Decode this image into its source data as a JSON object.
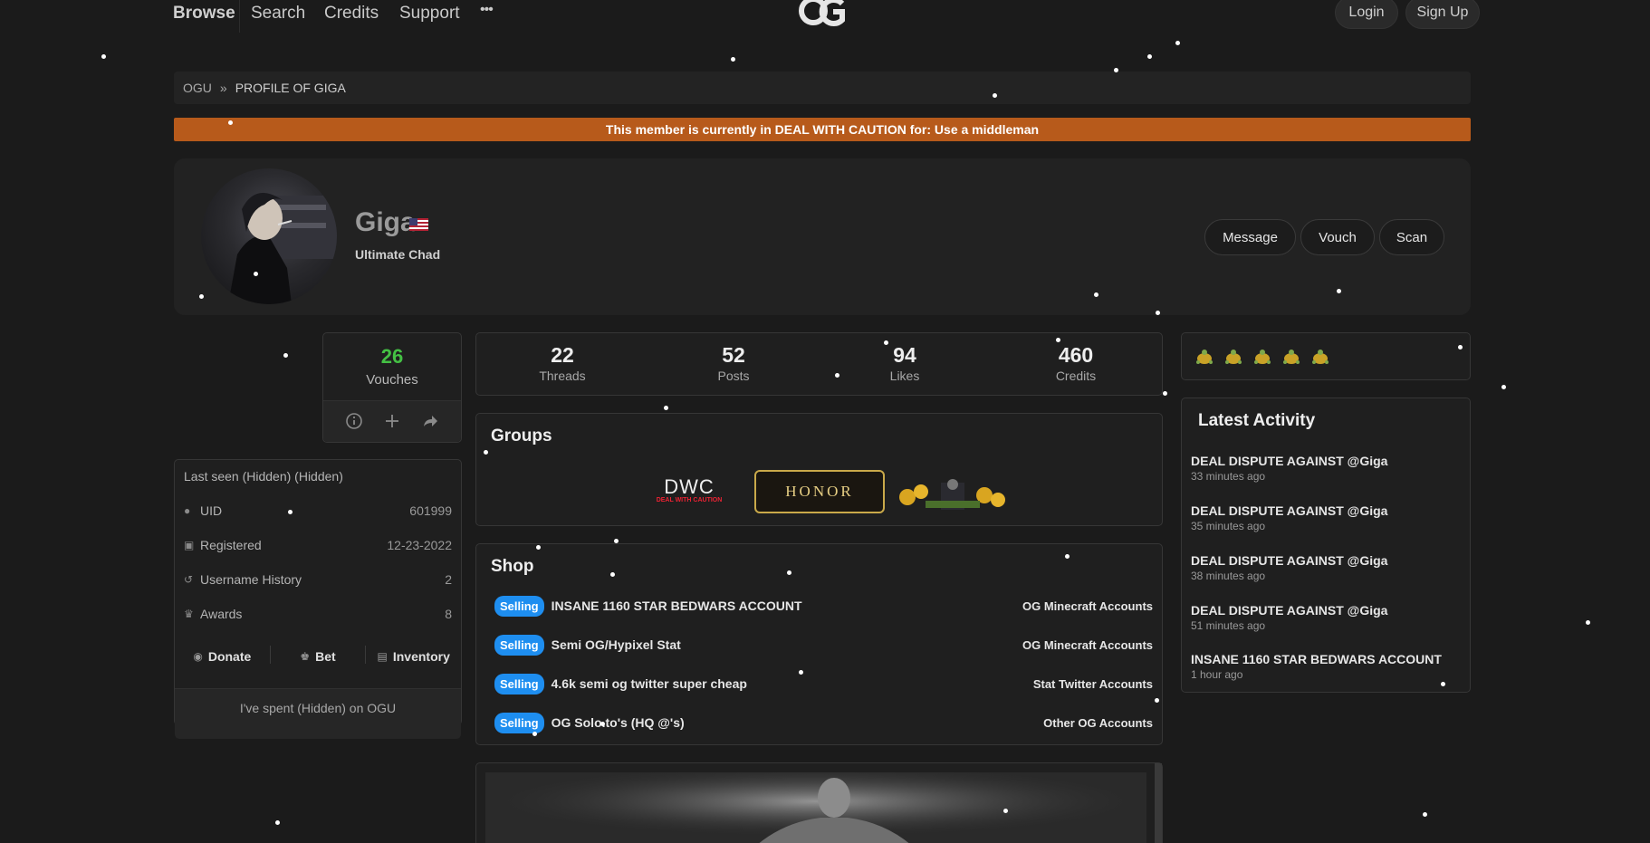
{
  "nav": {
    "links": [
      "Browse",
      "Search",
      "Credits",
      "Support"
    ],
    "more": "•••",
    "login": "Login",
    "signup": "Sign Up"
  },
  "breadcrumb": {
    "root": "OGU",
    "current": "PROFILE OF GIGA"
  },
  "caution_banner": "This member is currently in DEAL WITH CAUTION for: Use a middleman",
  "profile": {
    "username": "Giga",
    "user_title": "Ultimate Chad",
    "actions": [
      "Message",
      "Vouch",
      "Scan"
    ]
  },
  "vouches": {
    "count": "26",
    "label": "Vouches"
  },
  "info": {
    "last_seen": "Last seen (Hidden) (Hidden)",
    "rows": [
      {
        "label": "UID",
        "value": "601999"
      },
      {
        "label": "Registered",
        "value": "12-23-2022"
      },
      {
        "label": "Username History",
        "value": "2"
      },
      {
        "label": "Awards",
        "value": "8"
      }
    ],
    "links": [
      "Donate",
      "Bet",
      "Inventory"
    ],
    "spent": "I've spent (Hidden) on OGU"
  },
  "stats": [
    {
      "value": "22",
      "label": "Threads"
    },
    {
      "value": "52",
      "label": "Posts"
    },
    {
      "value": "94",
      "label": "Likes"
    },
    {
      "value": "460",
      "label": "Credits"
    }
  ],
  "groups": {
    "title": "Groups",
    "banners": [
      "DWC",
      "DEAL WITH CAUTION",
      "HONOR"
    ]
  },
  "shop": {
    "title": "Shop",
    "badge": "Selling",
    "items": [
      {
        "name": "INSANE 1160 STAR BEDWARS ACCOUNT",
        "category": "OG Minecraft Accounts"
      },
      {
        "name": "Semi OG/Hypixel Stat",
        "category": "OG Minecraft Accounts"
      },
      {
        "name": "4.6k semi og twitter super cheap",
        "category": "Stat Twitter Accounts"
      },
      {
        "name": "OG Solo.to's (HQ @'s)",
        "category": "Other OG Accounts"
      }
    ]
  },
  "activity": {
    "title": "Latest Activity",
    "items": [
      {
        "text": "DEAL DISPUTE AGAINST @Giga",
        "time": "33 minutes ago"
      },
      {
        "text": "DEAL DISPUTE AGAINST @Giga",
        "time": "35 minutes ago"
      },
      {
        "text": "DEAL DISPUTE AGAINST @Giga",
        "time": "38 minutes ago"
      },
      {
        "text": "DEAL DISPUTE AGAINST @Giga",
        "time": "51 minutes ago"
      },
      {
        "text": "INSANE 1160 STAR BEDWARS ACCOUNT",
        "time": "1 hour ago"
      }
    ]
  },
  "colors": {
    "caution": "#b75a1b",
    "selling_badge": "#1e8ef0",
    "vouch_count": "#44c044"
  }
}
